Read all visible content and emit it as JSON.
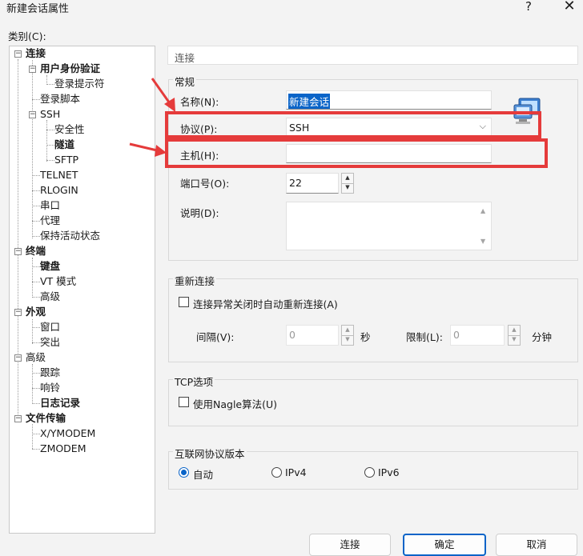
{
  "window": {
    "title": "新建会话属性",
    "help_glyph": "?",
    "close_glyph": "✕"
  },
  "category_label": "类别(C):",
  "tree": {
    "items": [
      {
        "label": "连接"
      },
      {
        "label": "用户身份验证"
      },
      {
        "label": "登录提示符"
      },
      {
        "label": "登录脚本"
      },
      {
        "label": "SSH"
      },
      {
        "label": "安全性"
      },
      {
        "label": "隧道"
      },
      {
        "label": "SFTP"
      },
      {
        "label": "TELNET"
      },
      {
        "label": "RLOGIN"
      },
      {
        "label": "串口"
      },
      {
        "label": "代理"
      },
      {
        "label": "保持活动状态"
      },
      {
        "label": "终端"
      },
      {
        "label": "键盘"
      },
      {
        "label": "VT 模式"
      },
      {
        "label": "高级"
      },
      {
        "label": "外观"
      },
      {
        "label": "窗口"
      },
      {
        "label": "突出"
      },
      {
        "label": "高级"
      },
      {
        "label": "跟踪"
      },
      {
        "label": "响铃"
      },
      {
        "label": "日志记录"
      },
      {
        "label": "文件传输"
      },
      {
        "label": "X/YMODEM"
      },
      {
        "label": "ZMODEM"
      }
    ]
  },
  "breadcrumb": "连接",
  "general": {
    "title": "常规",
    "name_label": "名称(N):",
    "name_value": "新建会话",
    "protocol_label": "协议(P):",
    "protocol_value": "SSH",
    "host_label": "主机(H):",
    "host_value": "",
    "port_label": "端口号(O):",
    "port_value": "22",
    "desc_label": "说明(D):",
    "desc_value": ""
  },
  "reconnect": {
    "title": "重新连接",
    "checkbox_label": "连接异常关闭时自动重新连接(A)",
    "interval_label": "间隔(V):",
    "interval_value": "0",
    "interval_unit": "秒",
    "limit_label": "限制(L):",
    "limit_value": "0",
    "limit_unit": "分钟"
  },
  "tcp": {
    "title": "TCP选项",
    "nagle_label": "使用Nagle算法(U)"
  },
  "ip_version": {
    "title": "互联网协议版本",
    "options": [
      {
        "label": "自动",
        "selected": true
      },
      {
        "label": "IPv4",
        "selected": false
      },
      {
        "label": "IPv6",
        "selected": false
      }
    ]
  },
  "buttons": {
    "connect": "连接",
    "ok": "确定",
    "cancel": "取消"
  },
  "colors": {
    "highlight_red": "#e53b3b",
    "accent_blue": "#0a64c8"
  },
  "icons": {
    "session": "session-computer-icon",
    "tree_toggle": "tree-collapse-icon"
  }
}
